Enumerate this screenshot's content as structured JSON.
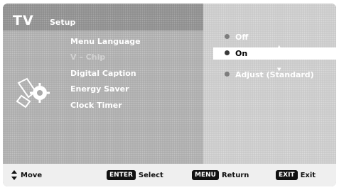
{
  "header": {
    "tv_label": "TV",
    "section_title": "Setup"
  },
  "menu": {
    "items": [
      "Menu Language",
      "V – Chip",
      "Digital Caption",
      "Energy Saver",
      "Clock Timer"
    ]
  },
  "options": {
    "items": [
      "Off",
      "On",
      "Adjust (Standard)"
    ],
    "selected": "On"
  },
  "footer": {
    "move_label": "Move",
    "select_key": "ENTER",
    "select_label": "Select",
    "return_key": "MENU",
    "return_label": "Return",
    "exit_key": "EXIT",
    "exit_label": "Exit"
  }
}
